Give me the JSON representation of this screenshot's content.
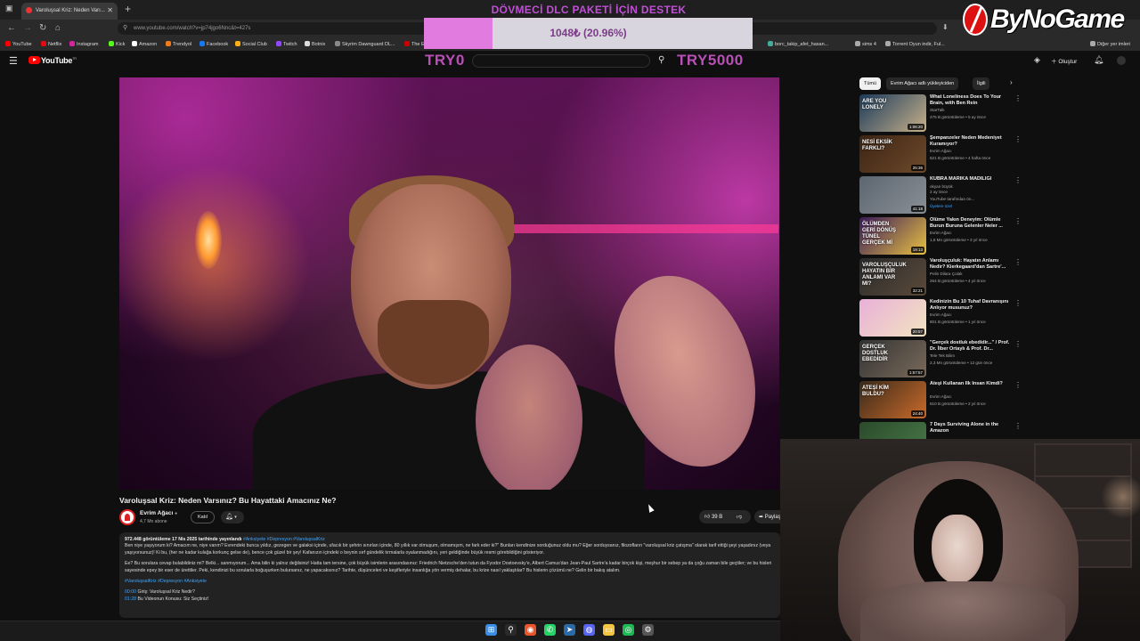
{
  "browser": {
    "tab_title": "Varoluşsal Kriz: Neden Varı...",
    "url": "www.youtube.com/watch?v=jp74jgo6Nnc&t=427s",
    "bookmarks": [
      "YouTube",
      "Netflix",
      "Instagram",
      "Kick",
      "Amazon",
      "Trendyol",
      "Facebook",
      "Social Club",
      "Twitch",
      "Botnix",
      "Skyrim Dawnguard DL...",
      "The E",
      "borc_takip_afet_hasan...",
      "sims 4",
      "Torrent Oyun indir, Ful...",
      "Diğer yer imleri"
    ]
  },
  "youtube": {
    "logo": "YouTube",
    "logo_region": "TR",
    "create_label": "Oluştur"
  },
  "donation": {
    "title": "DÖVMECİ DLC PAKETİ İÇİN DESTEK",
    "progress_text": "1048₺ (20.96%)",
    "progress_fraction": 0.2096,
    "min_label": "TRY0",
    "max_label": "TRY5000",
    "fill_color": "#e27be0",
    "text_color": "#c04fd6"
  },
  "brand": {
    "name": "ByNoGame"
  },
  "video": {
    "title": "Varoluşsal Kriz: Neden Varsınız? Bu Hayattaki Amacınız Ne?",
    "channel": "Evrim Ağacı",
    "subscribers": "4,7 Mn abone",
    "join_label": "Katıl",
    "likes": "39 B",
    "share_label": "Paylaş"
  },
  "description": {
    "meta": "972.448 görüntüleme  17 Nis 2025 tarihinde yayınlandı",
    "meta_tags": "#Anksiyete #Depresyon #VaroluşsalKriz",
    "paragraph1": "Ben niye yaşıyorum ki? Amacım ne, niye varım? Evrendeki bunca yıldız, gezegen ve galaksi içinde, ufacık bir şehrin sınırları içinde, 80 yıllık var olmuşum, olmamışım, ne fark eder ki?\" Bunları kendinize sorduğunuz oldu mu? Eğer sorduysanız, filozofların \"varoluşsal kriz çatışma\" olarak tarif ettiği şeyi yaşadınız (veya yaşıyorsunuz)! Ki bu, (her ne kadar kulağa korkunç gelse de), bence çok güzel bir şey! Kafanızın içindeki o beynin sırf gündelik tırmalarla oyalanmadığını, yeri geldiğinde büyük resmi görebildiğini gösteriyor.",
    "paragraph2": "Ee? Bu sorulara cevap bulabildiniz mi? Belki... sanmıyorum... Ama bilin ki yalnız değilsiniz! Hatta tam tersine, çok büyük isimlerin arasındasınız: Friedrich Nietzsche'den tutun da Fyodor Dostoevsky'e, Albert Camus'dan Jean-Paul Sartre'a kadar birçok kişi, meşhur bir sebep ya da çoğu zaman bile geçtiler; ve bu hisleri sayesinde epey bir eser de ürettiler. Peki, kendinizi bu sorularla boğuşurken bulursanız, ne yapacaksınız? Tarihte, düşünceleri ve keşifleriyle insanlığa yön vermiş dehalar, bu krize nasıl yaklaştılar? Bu hislerin çözümü ne? Gelin bir bakış atalım.",
    "tags": "#VaroluşsalKriz #Depresyon #Anksiyete",
    "chapter_time": "00:00",
    "chapter_label": "Giriş: Varoluşsal Kriz Nedir?",
    "chapter2_time": "01:28",
    "chapter2_label": "Bu Videonun Konusu: Siz Seçtiniz!"
  },
  "sidebar": {
    "chips": [
      "Tümü",
      "Evrim Ağacı adlı yükleyiciden",
      "İlgili"
    ],
    "recommendations": [
      {
        "title": "What Loneliness Does To Your Brain, with Ben Rein",
        "channel": "StarTalk",
        "views": "475 B görüntüleme • 5 ay önce",
        "duration": "1:06:20",
        "thumb_text": "ARE YOU LONELY",
        "c1": "#1a3b5a",
        "c2": "#c7b08a"
      },
      {
        "title": "Şempanzeler Neden Medeniyet Kuramıyor?",
        "channel": "Evrim Ağacı",
        "views": "521 B görüntüleme • 4 hafta önce",
        "duration": "25:36",
        "thumb_text": "NESİ EKSİK FARKLI?",
        "c1": "#3d2414",
        "c2": "#6d4a2a"
      },
      {
        "title": "KÜBRA MARİKA MADİLİĞİ",
        "channel": "okyan büyük",
        "views": "2 ay önce",
        "duration": "41:18",
        "thumb_text": "",
        "c1": "#5c6670",
        "c2": "#8a8f96",
        "badge": "Üyelere özel",
        "extra": "YouTube tarafından ön..."
      },
      {
        "title": "Ölüme Yakın Deneyim: Ölümle Burun Buruna Gelenler Neler ...",
        "channel": "Evrim Ağacı",
        "views": "1,6 Mn görüntüleme • 3 yıl önce",
        "duration": "19:13",
        "thumb_text": "ÖLÜMDEN GERİ DÖNÜŞ TÜNEL GERÇEK Mİ",
        "c1": "#3a1a5a",
        "c2": "#e9c241"
      },
      {
        "title": "Varoluşçuluk: Hayatın Anlamı Nedir? Kierkegaard'dan Sartre'...",
        "channel": "Pelin Dilara Çolak",
        "views": "264 B görüntüleme • 4 yıl önce",
        "duration": "32:21",
        "thumb_text": "VAROLUŞÇULUK HAYATIN BİR ANLAMI VAR MI?",
        "c1": "#2a2a2a",
        "c2": "#5a4a3a"
      },
      {
        "title": "Kedinizin Bu 10 Tuhaf Davranışını Anlıyor musunuz?",
        "channel": "Evrim Ağacı",
        "views": "801 B görüntüleme • 1 yıl önce",
        "duration": "20:57",
        "thumb_text": "",
        "c1": "#e9b0d8",
        "c2": "#f2e3c0"
      },
      {
        "title": "\"Gerçek dostluk ebedidir...\" / Prof. Dr. İlber Ortaylı & Prof. Dr...",
        "channel": "Tele Tek Bilim",
        "views": "2,3 Mn görüntüleme • 12 gün önce",
        "duration": "1:57:57",
        "thumb_text": "GERÇEK DOSTLUK EBEDİDİR",
        "c1": "#333333",
        "c2": "#7a6a5a"
      },
      {
        "title": "Ateşi Kullanan İlk İnsan Kimdi?",
        "channel": "Evrim Ağacı",
        "views": "610 B görüntüleme • 2 yıl önce",
        "duration": "24:40",
        "thumb_text": "ATEŞİ KİM BULDU?",
        "c1": "#3a2a1a",
        "c2": "#c96a2a"
      },
      {
        "title": "7 Days Surviving Alone in the Amazon",
        "channel": "",
        "views": "",
        "duration": "",
        "thumb_text": "",
        "c1": "#2a4a2a",
        "c2": "#4a7a4a"
      }
    ]
  },
  "taskbar": {
    "icons": [
      "windows-start-icon",
      "search-icon",
      "firefox-icon",
      "whatsapp-icon",
      "steam-icon",
      "discord-icon",
      "file-explorer-icon",
      "spotify-icon",
      "settings-icon"
    ]
  }
}
